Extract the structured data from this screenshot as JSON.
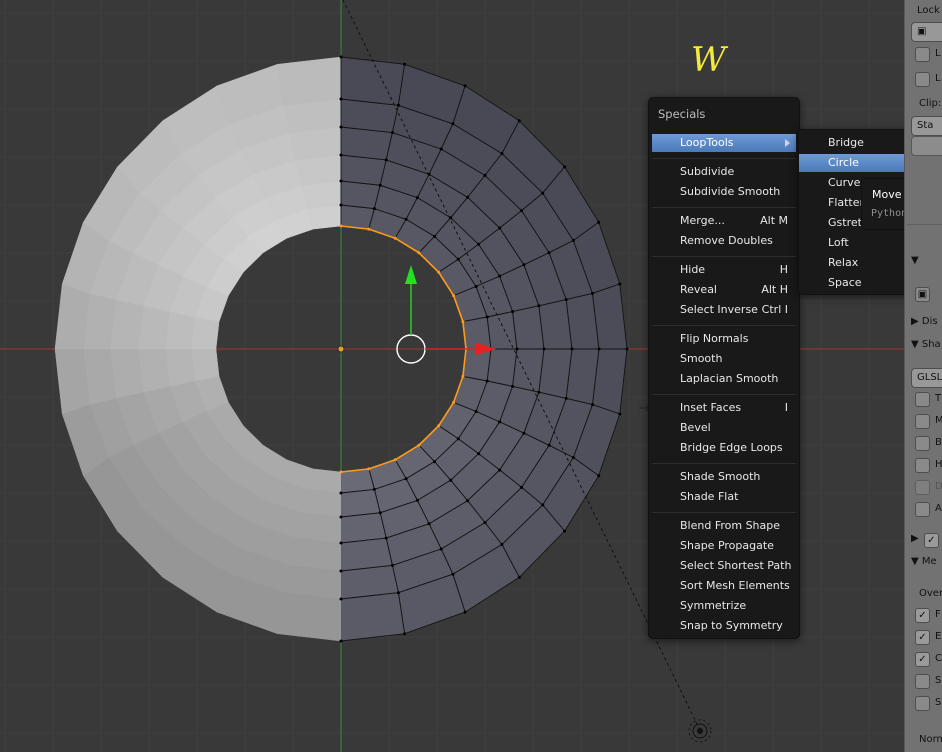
{
  "annotation": {
    "key_hint": "W"
  },
  "specials_menu": {
    "title": "Specials",
    "groups": [
      [
        {
          "label": "LoopTools",
          "shortcut": "",
          "has_submenu": true,
          "active": true
        }
      ],
      [
        {
          "label": "Subdivide",
          "shortcut": ""
        },
        {
          "label": "Subdivide Smooth",
          "shortcut": ""
        }
      ],
      [
        {
          "label": "Merge...",
          "shortcut": "Alt M"
        },
        {
          "label": "Remove Doubles",
          "shortcut": ""
        }
      ],
      [
        {
          "label": "Hide",
          "shortcut": "H"
        },
        {
          "label": "Reveal",
          "shortcut": "Alt H"
        },
        {
          "label": "Select Inverse",
          "shortcut": "Ctrl I"
        }
      ],
      [
        {
          "label": "Flip Normals",
          "shortcut": ""
        },
        {
          "label": "Smooth",
          "shortcut": ""
        },
        {
          "label": "Laplacian Smooth",
          "shortcut": ""
        }
      ],
      [
        {
          "label": "Inset Faces",
          "shortcut": "I"
        },
        {
          "label": "Bevel",
          "shortcut": ""
        },
        {
          "label": "Bridge Edge Loops",
          "shortcut": ""
        }
      ],
      [
        {
          "label": "Shade Smooth",
          "shortcut": ""
        },
        {
          "label": "Shade Flat",
          "shortcut": ""
        }
      ],
      [
        {
          "label": "Blend From Shape",
          "shortcut": ""
        },
        {
          "label": "Shape Propagate",
          "shortcut": ""
        },
        {
          "label": "Select Shortest Path",
          "shortcut": ""
        },
        {
          "label": "Sort Mesh Elements",
          "shortcut": ""
        },
        {
          "label": "Symmetrize",
          "shortcut": ""
        },
        {
          "label": "Snap to Symmetry",
          "shortcut": ""
        }
      ]
    ]
  },
  "looptools_submenu": {
    "items": [
      {
        "label": "Bridge",
        "active": false
      },
      {
        "label": "Circle",
        "active": true
      },
      {
        "label": "Curve",
        "active": false
      },
      {
        "label": "Flatten",
        "active": false
      },
      {
        "label": "Gstretch",
        "active": false
      },
      {
        "label": "Loft",
        "active": false
      },
      {
        "label": "Relax",
        "active": false
      },
      {
        "label": "Space",
        "active": false
      }
    ]
  },
  "tooltip": {
    "title": "Move selected",
    "python": "Python: bpy."
  },
  "properties_panel": {
    "lock_label": "Lock",
    "clip_label": "Clip:",
    "clip_start": "Sta",
    "display_label": "Dis",
    "shading_label": "Sha",
    "glsl_value": "GLSL",
    "mesh_display_label": "Me",
    "overlays_label": "Over",
    "normals_label": "Norm",
    "checkbox_letters": [
      "T",
      "M",
      "B",
      "H",
      "D",
      "A"
    ],
    "overlay_letters": [
      "F",
      "E",
      "C",
      "S",
      "S"
    ],
    "colors": {
      "bg": "#727272"
    }
  },
  "colors": {
    "viewport_bg": "#393939",
    "grid": "#404040",
    "x_axis": "#b03535",
    "y_axis": "#3a8f3a",
    "selection": "#ff9a1a",
    "highlight": "#f3ea3c",
    "menu_bg": "#191919",
    "menu_active": "#5a87c6"
  }
}
